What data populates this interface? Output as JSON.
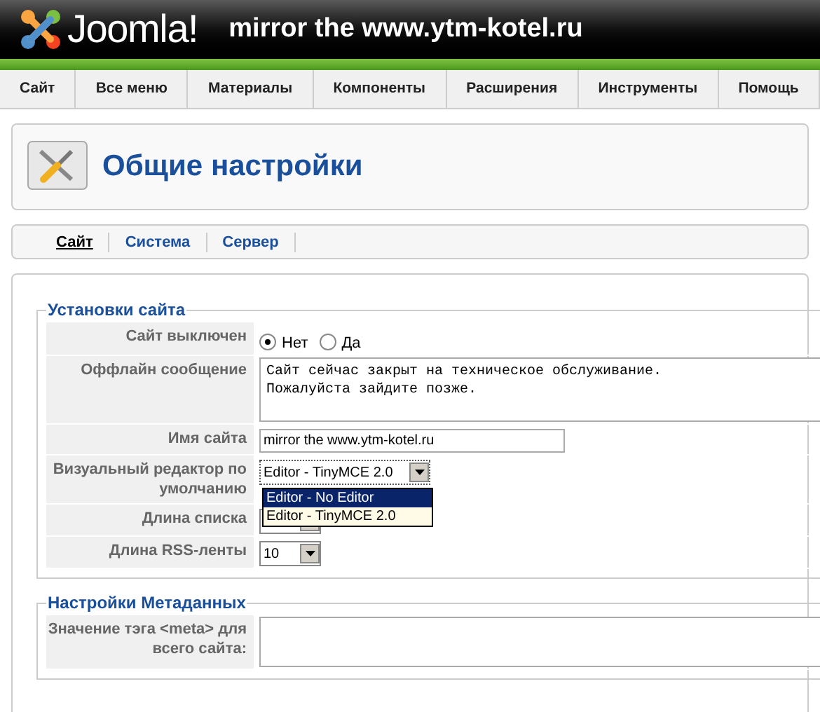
{
  "header": {
    "logo_text": "Joomla!",
    "site_title": "mirror the www.ytm-kotel.ru"
  },
  "menu": [
    "Сайт",
    "Все меню",
    "Материалы",
    "Компоненты",
    "Расширения",
    "Инструменты",
    "Помощь"
  ],
  "page_title": "Общие настройки",
  "tabs": [
    {
      "label": "Сайт",
      "selected": true
    },
    {
      "label": "Система",
      "selected": false
    },
    {
      "label": "Сервер",
      "selected": false
    }
  ],
  "sections": [
    {
      "legend": "Установки сайта",
      "rows": [
        {
          "kind": "radio",
          "label": "Сайт выключен",
          "options": [
            {
              "label": "Нет",
              "selected": true
            },
            {
              "label": "Да",
              "selected": false
            }
          ]
        },
        {
          "kind": "textarea",
          "label": "Оффлайн сообщение",
          "value": "Сайт сейчас закрыт на техническое обслуживание.\nПожалуйста зайдите позже."
        },
        {
          "kind": "text",
          "label": "Имя сайта",
          "value": "mirror the www.ytm-kotel.ru"
        },
        {
          "kind": "select",
          "label": "Визуальный редактор по умолчанию",
          "value": "Editor - TinyMCE 2.0",
          "expanded": true,
          "options": [
            {
              "label": "Editor - No Editor",
              "highlighted": true
            },
            {
              "label": "Editor - TinyMCE 2.0",
              "highlighted": false
            }
          ]
        },
        {
          "kind": "select",
          "label": "Длина списка",
          "expanded": false
        },
        {
          "kind": "select",
          "label": "Длина RSS-ленты",
          "value": "10",
          "expanded": false
        }
      ]
    },
    {
      "legend": "Настройки Метаданных",
      "rows": [
        {
          "kind": "textarea",
          "label": "Значение тэга <meta> для всего сайта:"
        }
      ]
    }
  ]
}
